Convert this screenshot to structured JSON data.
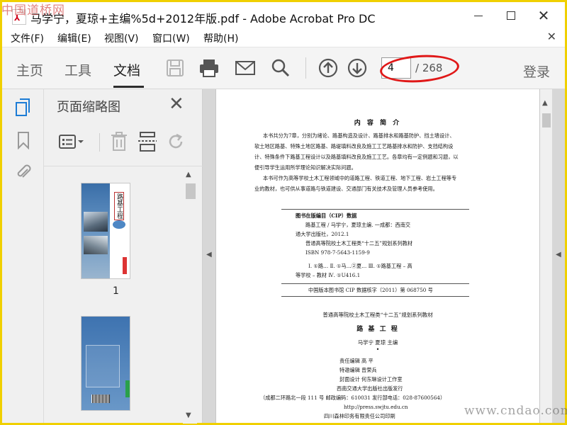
{
  "window": {
    "title": "马学宁，夏琼+主编%5d+2012年版.pdf - Adobe Acrobat Pro DC",
    "watermark_top": "中国道桥网"
  },
  "menu": [
    "文件(F)",
    "编辑(E)",
    "视图(V)",
    "窗口(W)",
    "帮助(H)"
  ],
  "toolbar": {
    "tabs": [
      "主页",
      "工具",
      "文档"
    ],
    "active_tab": "文档",
    "current_page": "4",
    "total_pages": "/ 268",
    "login": "登录"
  },
  "thumbnails_panel": {
    "title": "页面缩略图",
    "thumb1_title": "路基工程",
    "page_label": "1"
  },
  "document": {
    "heading": "内 容 简 介",
    "summary_lines": [
      "本书共分为7章，分别为绪论、路基构造及设计、路基排水和路基防护、挡土墙设计、",
      "软土地区路基、特殊土地区路基、路堤填料改良及施工工艺路基排水和防护、支挡结构设",
      "计、特殊条件下路基工程设计以及路基填料改良及施工工艺。各章均有一定例题和习题，以",
      "便引导学生运用所学理论知识解决实际问题。",
      "本书可作为高等学校土木工程领域中的道路工程、铁道工程、地下工程、岩土工程等专",
      "业的教材，也可供从事道路与铁道建设、交通部门有关技术及管理人员参考使用。"
    ],
    "cip_title": "图书在版编目（CIP）数据",
    "cip_lines": [
      "路基工程 / 马学宁，夏琼主编. 一成都：西南交",
      "通大学出版社，2012.1",
      "普通高等院校土木工程类“十二五”规划系列教材",
      "ISBN 978-7-5643-1159-9",
      "Ⅰ. ①路…  Ⅱ. ①马…②夏…  Ⅲ. ①路基工程 – 高",
      "等学校 – 教材  Ⅳ. ①U416.1"
    ],
    "cip_number": "中国版本图书馆 CIP 数据核字（2011）第 068750 号",
    "series": "普通高等院校土木工程类“十二五”规划系列教材",
    "book_title": "路 基 工 程",
    "editors": "马学宁    夏琼    主编",
    "bullet": "•",
    "credits": [
      "责任编辑    高  平",
      "特邀编辑    曾荣兵",
      "封面设计    何东琳设计工作室"
    ],
    "publisher_lines": [
      "西南交通大学出版社出版发行",
      "（成都二环路北一段 111 号   邮政编码：610031   发行部电话：028-87600564）",
      "http://press.swjtu.edu.cn",
      "四川森林印务有限责任公司印刷"
    ],
    "watermark_br": "www.cndao.com"
  }
}
